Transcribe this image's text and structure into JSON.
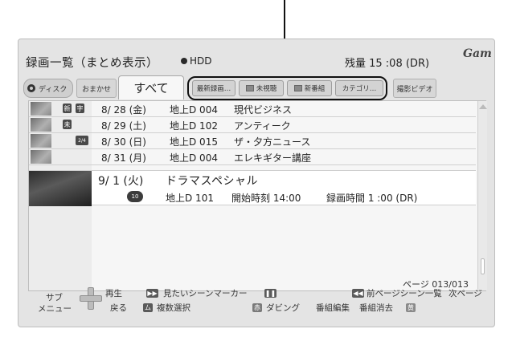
{
  "header": {
    "title": "録画一覧（まとめ表示）",
    "drive": "HDD",
    "remaining": "残量 15 :08 (DR)",
    "logo": "Gam"
  },
  "tabs": {
    "disc": "ディスク",
    "auto": "おまかせ",
    "all": "すべて",
    "latest": "最新録画…",
    "unviewed": "未視聴",
    "new_program": "新番組",
    "category": "カテゴリ…",
    "home_video": "撮影ビデオ"
  },
  "rows": [
    {
      "date": "8/ 28 (金)",
      "channel": "地上D 004",
      "name": "現代ビジネス",
      "badges": [
        "新",
        "字"
      ]
    },
    {
      "date": "8/ 29 (土)",
      "channel": "地上D 102",
      "name": "アンティーク",
      "badges": [
        "未"
      ]
    },
    {
      "date": "8/ 30 (日)",
      "channel": "地上D 015",
      "name": "ザ・夕方ニュース",
      "badges": [
        "2/4"
      ]
    },
    {
      "date": "8/ 31 (月)",
      "channel": "地上D 004",
      "name": "エレキギター講座",
      "badges": []
    }
  ],
  "selected": {
    "date": "9/ 1 (火)",
    "name": "ドラマスペシャル",
    "badge": "10",
    "channel": "地上D 101",
    "start": "開始時刻 14:00",
    "duration": "録画時間 1 :00 (DR)"
  },
  "footer": {
    "page": "ページ 013/013",
    "sub": "サブ",
    "menu": "メニュー",
    "play": "再生",
    "back": "戻る",
    "scene_marker": "見たいシーンマーカー",
    "multi_select": "複数選択",
    "dubbing": "ダビング",
    "edit_program": "番組編集",
    "erase_program": "番組消去",
    "prev_page": "前ページ",
    "scene_list": "シーン一覧",
    "next_page": "次ページ"
  },
  "keys": {
    "red": "赤",
    "yellow": "黄",
    "multi": "ム"
  }
}
